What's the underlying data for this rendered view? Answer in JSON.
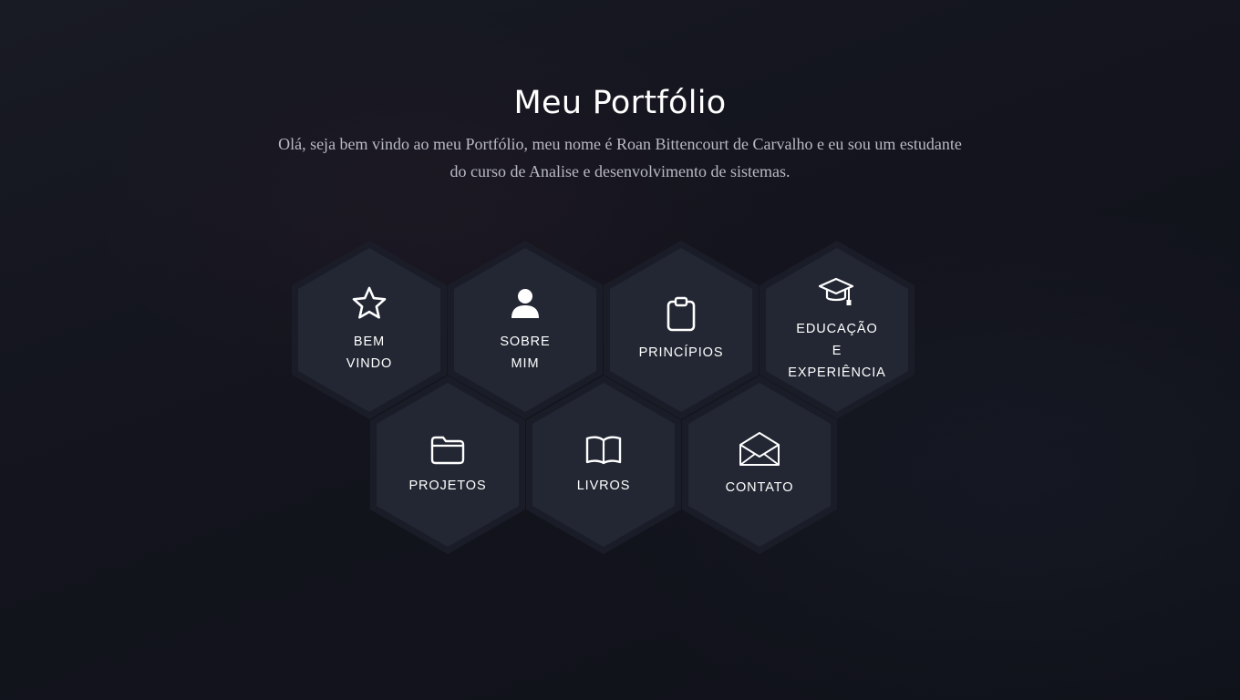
{
  "header": {
    "title": "Meu Portfólio",
    "intro": "Olá, seja bem vindo ao meu Portfólio, meu nome é Roan Bittencourt de Carvalho e eu sou um estudante do curso de Analise e desenvolvimento de sistemas."
  },
  "colors": {
    "background": "#141620",
    "hex_fill": "#222733",
    "hex_border": "#1a1d27",
    "text": "#ffffff",
    "intro_text": "#b8bac4"
  },
  "nav": {
    "items": [
      {
        "label": "BEM\nVINDO",
        "icon": "star-icon"
      },
      {
        "label": "SOBRE\nMIM",
        "icon": "user-icon"
      },
      {
        "label": "PRINCÍPIOS",
        "icon": "clipboard-icon"
      },
      {
        "label": "EDUCAÇÃO\nE\nEXPERIÊNCIA",
        "icon": "graduation-cap-icon"
      },
      {
        "label": "PROJETOS",
        "icon": "folder-icon"
      },
      {
        "label": "LIVROS",
        "icon": "book-icon"
      },
      {
        "label": "CONTATO",
        "icon": "envelope-icon"
      }
    ]
  }
}
